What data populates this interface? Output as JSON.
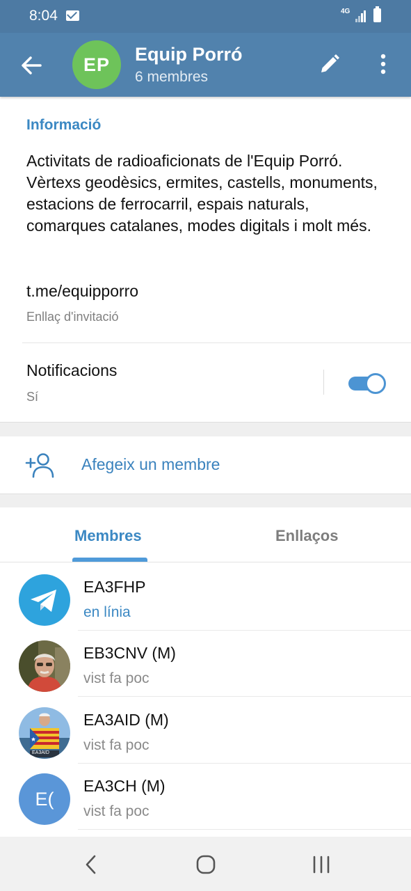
{
  "status_bar": {
    "time": "8:04",
    "network": "4G",
    "icons": [
      "mail-icon",
      "signal-icon",
      "battery-icon"
    ]
  },
  "header": {
    "avatar_initials": "EP",
    "title": "Equip Porró",
    "subtitle": "6 membres"
  },
  "info": {
    "section_label": "Informació",
    "description": "Activitats de radioaficionats de l'Equip Porró. Vèrtexs geodèsics, ermites, castells, monuments, estacions de ferrocarril, espais naturals, comarques catalanes, modes digitals i molt més.",
    "link": "t.me/equipporro",
    "link_caption": "Enllaç d'invitació"
  },
  "notifications": {
    "title": "Notificacions",
    "value": "Sí",
    "enabled": true
  },
  "add_member": {
    "label": "Afegeix un membre"
  },
  "tabs": [
    {
      "label": "Membres",
      "active": true
    },
    {
      "label": "Enllaços",
      "active": false
    }
  ],
  "members": [
    {
      "name": "EA3FHP",
      "status": "en línia",
      "avatar": "telegram-logo"
    },
    {
      "name": "EB3CNV (M)",
      "status": "vist fa poc",
      "avatar": "photo"
    },
    {
      "name": "EA3AID (M)",
      "status": "vist fa poc",
      "avatar": "photo",
      "avatar_caption": "EA3AID"
    },
    {
      "name": "EA3CH (M)",
      "status": "vist fa poc",
      "avatar_initials": "E("
    }
  ],
  "colors": {
    "app_bar": "#5182ad",
    "status_bar": "#4d7aa3",
    "accent": "#3b88c3",
    "header_avatar": "#6ec35a",
    "member_avatar": "#5a96d8"
  }
}
